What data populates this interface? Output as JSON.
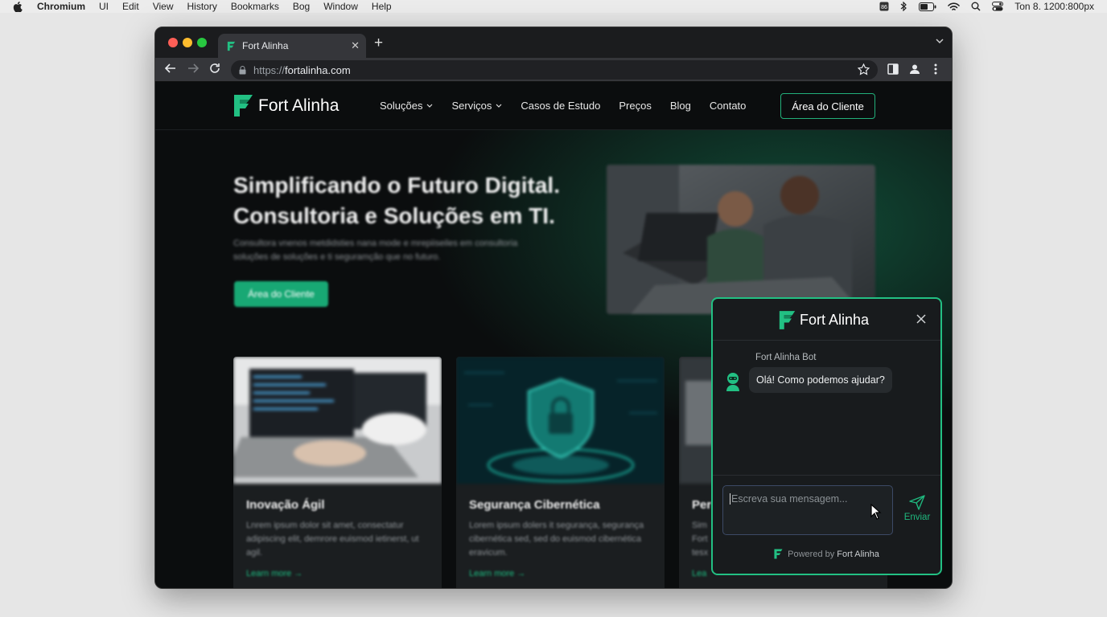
{
  "menubar": {
    "app": "Chromium",
    "items": [
      "UI",
      "Edit",
      "View",
      "History",
      "Bookmarks",
      "Bog",
      "Window",
      "Help"
    ],
    "clock": "Ton 8. 1200:800px",
    "icons": [
      "apple-icon",
      "keyboard-icon",
      "bluetooth-icon",
      "battery-icon",
      "wifi-icon",
      "search-icon",
      "control-center-icon"
    ]
  },
  "browser": {
    "tab_title": "Fort Alinha",
    "url_protocol": "https://",
    "url_host": "fortalinha.com"
  },
  "site": {
    "logo_text": "Fort Alinha",
    "nav": [
      {
        "label": "Soluções",
        "dropdown": true
      },
      {
        "label": "Serviços",
        "dropdown": true
      },
      {
        "label": "Casos de Estudo",
        "dropdown": false
      },
      {
        "label": "Preços",
        "dropdown": false
      },
      {
        "label": "Blog",
        "dropdown": false
      },
      {
        "label": "Contato",
        "dropdown": false
      }
    ],
    "client_area_button": "Área do Cliente",
    "hero": {
      "title_line1": "Simplificando o Futuro Digital.",
      "title_line2": "Consultoria e Soluções em TI.",
      "subtitle_line1": "Consultora vnenos metdidsties nana mode e mrepiiseiles em consultoria",
      "subtitle_line2": "soluções de soluções e ti seguramção que no futuro.",
      "cta": "Área do Cliente"
    },
    "cards": [
      {
        "title": "Inovação Ágil",
        "text": "Lnrem ipsum dolor sit amet, consectatur adipiscing elit, demrore euismod ietinerst, ut agil.",
        "link": "Learn more →"
      },
      {
        "title": "Segurança Cibernética",
        "text": "Lorem ipsum dolers it segurança, segurança cibernética sed, sed do euismod cibernética eravicum.",
        "link": "Learn more →"
      },
      {
        "title": "Per",
        "text": "Sim Fort tesx",
        "link": "Lea"
      }
    ]
  },
  "chat": {
    "header_title": "Fort Alinha",
    "bot_name": "Fort Alinha Bot",
    "bot_message": "Olá! Como podemos ajudar?",
    "input_placeholder": "Escreva sua mensagem...",
    "send_label": "Enviar",
    "powered_by": "Powered by",
    "powered_brand": "Fort Alinha"
  },
  "colors": {
    "accent": "#22c083",
    "page_bg": "#0b0d0e",
    "chat_bg": "#181b1d"
  }
}
